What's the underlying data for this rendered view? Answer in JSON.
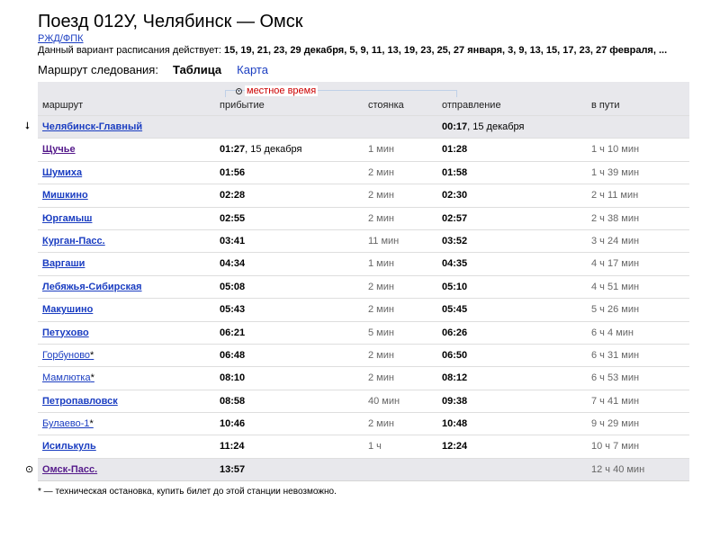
{
  "page": {
    "title": "Поезд 012У, Челябинск — Омск",
    "carrier": "РЖД/ФПК",
    "schedule_label": "Данный вариант расписания действует:",
    "schedule_dates": "15, 19, 21, 23, 29 декабря, 5, 9, 11, 13, 19, 23, 25, 27 января, 3, 9, 13, 15, 17, 23, 27 февраля, ...",
    "route_label": "Маршрут следования:",
    "view_table": "Таблица",
    "view_map": "Карта",
    "local_time": "местное время",
    "footnote": "* — техническая остановка, купить билет до этой станции невозможно."
  },
  "table": {
    "headers": {
      "route": "маршрут",
      "arrival": "прибытие",
      "stop": "стоянка",
      "departure": "отправление",
      "travel": "в пути"
    },
    "rows": [
      {
        "station": "Челябинск-Главный",
        "arr": "",
        "arr_date": "",
        "stop": "",
        "dep": "00:17",
        "dep_date": ", 15 декабря",
        "travel": "",
        "bold": true,
        "visited": false,
        "tech": false,
        "hl": true,
        "marker": "start"
      },
      {
        "station": "Щучье",
        "arr": "01:27",
        "arr_date": ", 15 декабря",
        "stop": "1 мин",
        "dep": "01:28",
        "dep_date": "",
        "travel": "1 ч 10 мин",
        "bold": true,
        "visited": true,
        "tech": false,
        "hl": false,
        "marker": ""
      },
      {
        "station": "Шумиха",
        "arr": "01:56",
        "arr_date": "",
        "stop": "2 мин",
        "dep": "01:58",
        "dep_date": "",
        "travel": "1 ч 39 мин",
        "bold": true,
        "visited": false,
        "tech": false,
        "hl": false,
        "marker": ""
      },
      {
        "station": "Мишкино",
        "arr": "02:28",
        "arr_date": "",
        "stop": "2 мин",
        "dep": "02:30",
        "dep_date": "",
        "travel": "2 ч 11 мин",
        "bold": true,
        "visited": false,
        "tech": false,
        "hl": false,
        "marker": ""
      },
      {
        "station": "Юргамыш",
        "arr": "02:55",
        "arr_date": "",
        "stop": "2 мин",
        "dep": "02:57",
        "dep_date": "",
        "travel": "2 ч 38 мин",
        "bold": true,
        "visited": false,
        "tech": false,
        "hl": false,
        "marker": ""
      },
      {
        "station": "Курган-Пасс.",
        "arr": "03:41",
        "arr_date": "",
        "stop": "11 мин",
        "dep": "03:52",
        "dep_date": "",
        "travel": "3 ч 24 мин",
        "bold": true,
        "visited": false,
        "tech": false,
        "hl": false,
        "marker": ""
      },
      {
        "station": "Варгаши",
        "arr": "04:34",
        "arr_date": "",
        "stop": "1 мин",
        "dep": "04:35",
        "dep_date": "",
        "travel": "4 ч 17 мин",
        "bold": true,
        "visited": false,
        "tech": false,
        "hl": false,
        "marker": ""
      },
      {
        "station": "Лебяжья-Сибирская",
        "arr": "05:08",
        "arr_date": "",
        "stop": "2 мин",
        "dep": "05:10",
        "dep_date": "",
        "travel": "4 ч 51 мин",
        "bold": true,
        "visited": false,
        "tech": false,
        "hl": false,
        "marker": ""
      },
      {
        "station": "Макушино",
        "arr": "05:43",
        "arr_date": "",
        "stop": "2 мин",
        "dep": "05:45",
        "dep_date": "",
        "travel": "5 ч 26 мин",
        "bold": true,
        "visited": false,
        "tech": false,
        "hl": false,
        "marker": ""
      },
      {
        "station": "Петухово",
        "arr": "06:21",
        "arr_date": "",
        "stop": "5 мин",
        "dep": "06:26",
        "dep_date": "",
        "travel": "6 ч 4 мин",
        "bold": true,
        "visited": false,
        "tech": false,
        "hl": false,
        "marker": ""
      },
      {
        "station": "Горбуново",
        "arr": "06:48",
        "arr_date": "",
        "stop": "2 мин",
        "dep": "06:50",
        "dep_date": "",
        "travel": "6 ч 31 мин",
        "bold": false,
        "visited": false,
        "tech": true,
        "hl": false,
        "marker": ""
      },
      {
        "station": "Мамлютка",
        "arr": "08:10",
        "arr_date": "",
        "stop": "2 мин",
        "dep": "08:12",
        "dep_date": "",
        "travel": "6 ч 53 мин",
        "bold": false,
        "visited": false,
        "tech": true,
        "hl": false,
        "marker": ""
      },
      {
        "station": "Петропавловск",
        "arr": "08:58",
        "arr_date": "",
        "stop": "40 мин",
        "dep": "09:38",
        "dep_date": "",
        "travel": "7 ч 41 мин",
        "bold": true,
        "visited": false,
        "tech": false,
        "hl": false,
        "marker": ""
      },
      {
        "station": "Булаево-1",
        "arr": "10:46",
        "arr_date": "",
        "stop": "2 мин",
        "dep": "10:48",
        "dep_date": "",
        "travel": "9 ч 29 мин",
        "bold": false,
        "visited": false,
        "tech": true,
        "hl": false,
        "marker": ""
      },
      {
        "station": "Исилькуль",
        "arr": "11:24",
        "arr_date": "",
        "stop": "1 ч",
        "dep": "12:24",
        "dep_date": "",
        "travel": "10 ч 7 мин",
        "bold": true,
        "visited": false,
        "tech": false,
        "hl": false,
        "marker": ""
      },
      {
        "station": "Омск-Пасс.",
        "arr": "13:57",
        "arr_date": "",
        "stop": "",
        "dep": "",
        "dep_date": "",
        "travel": "12 ч 40 мин",
        "bold": true,
        "visited": true,
        "tech": false,
        "hl": true,
        "marker": "end"
      }
    ]
  },
  "markers": {
    "start": "⭣",
    "end": "⊙"
  }
}
